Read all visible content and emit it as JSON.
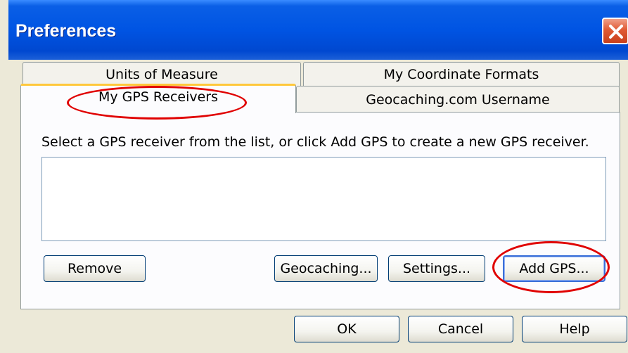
{
  "window": {
    "title": "Preferences",
    "close_icon": "close-icon"
  },
  "tabs": {
    "units": "Units of Measure",
    "coordinates": "My Coordinate Formats",
    "receivers": "My GPS Receivers",
    "username": "Geocaching.com Username"
  },
  "receivers_panel": {
    "instruction": "Select a GPS receiver from the list, or click Add GPS to create a new GPS receiver.",
    "receivers": [],
    "buttons": {
      "remove": "Remove",
      "geocaching": "Geocaching...",
      "settings": "Settings...",
      "add_gps": "Add GPS..."
    }
  },
  "dialog_buttons": {
    "ok": "OK",
    "cancel": "Cancel",
    "help": "Help"
  },
  "colors": {
    "titlebar": "#0054e3",
    "active_tab_highlight": "#ffc83c",
    "annotation": "#e00000"
  }
}
